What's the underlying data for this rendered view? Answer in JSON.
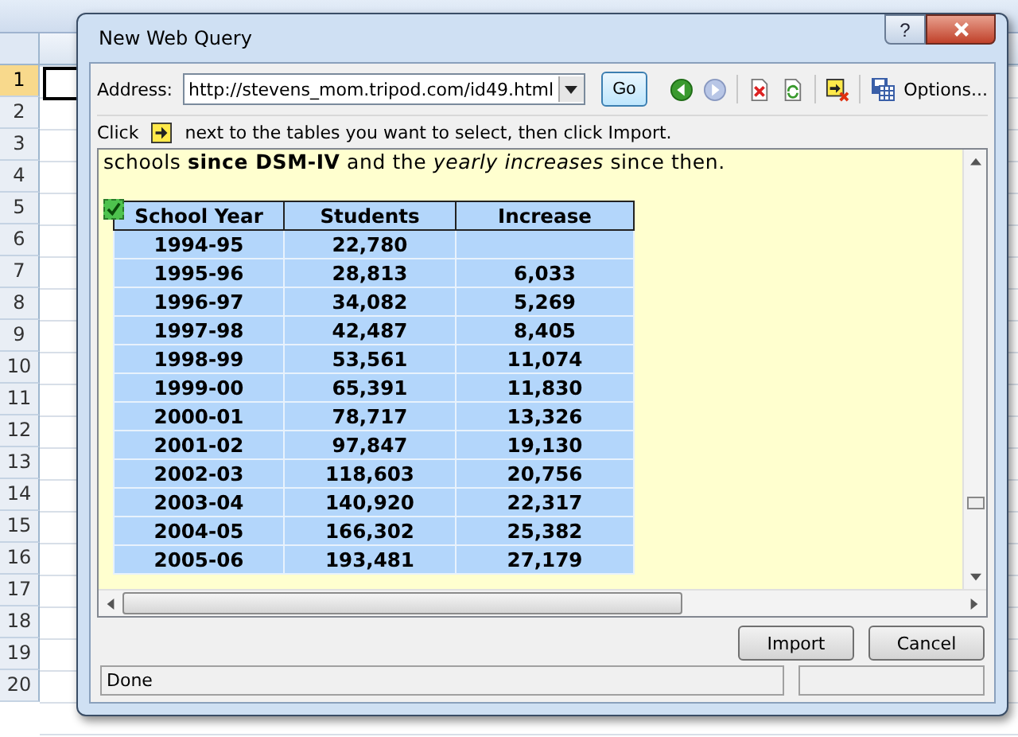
{
  "sheet": {
    "rows": [
      {
        "label": "1",
        "selected": true
      },
      {
        "label": "2",
        "selected": false
      },
      {
        "label": "3",
        "selected": false
      },
      {
        "label": "4",
        "selected": false
      },
      {
        "label": "5",
        "selected": false
      },
      {
        "label": "6",
        "selected": false
      },
      {
        "label": "7",
        "selected": false
      },
      {
        "label": "8",
        "selected": false
      },
      {
        "label": "9",
        "selected": false
      },
      {
        "label": "10",
        "selected": false
      },
      {
        "label": "11",
        "selected": false
      },
      {
        "label": "12",
        "selected": false
      },
      {
        "label": "13",
        "selected": false
      },
      {
        "label": "14",
        "selected": false
      },
      {
        "label": "15",
        "selected": false
      },
      {
        "label": "16",
        "selected": false
      },
      {
        "label": "17",
        "selected": false
      },
      {
        "label": "18",
        "selected": false
      },
      {
        "label": "19",
        "selected": false
      },
      {
        "label": "20",
        "selected": false
      }
    ]
  },
  "window": {
    "title": "New Web Query",
    "help": "?"
  },
  "address": {
    "label": "Address:",
    "value": "http://stevens_mom.tripod.com/id49.html",
    "go": "Go",
    "options": "Options..."
  },
  "instruction": {
    "before": "Click",
    "after": "next to the tables you want to select, then click Import."
  },
  "page": {
    "intro": "schools **since DSM-IV** and the *yearly increases* since then.",
    "table": {
      "checked": true,
      "columns": [
        "School Year",
        "Students",
        "Increase"
      ],
      "rows": [
        [
          "1994-95",
          "22,780",
          ""
        ],
        [
          "1995-96",
          "28,813",
          "6,033"
        ],
        [
          "1996-97",
          "34,082",
          "5,269"
        ],
        [
          "1997-98",
          "42,487",
          "8,405"
        ],
        [
          "1998-99",
          "53,561",
          "11,074"
        ],
        [
          "1999-00",
          "65,391",
          "11,830"
        ],
        [
          "2000-01",
          "78,717",
          "13,326"
        ],
        [
          "2001-02",
          "97,847",
          "19,130"
        ],
        [
          "2002-03",
          "118,603",
          "20,756"
        ],
        [
          "2003-04",
          "140,920",
          "22,317"
        ],
        [
          "2004-05",
          "166,302",
          "25,382"
        ],
        [
          "2005-06",
          "193,481",
          "27,179"
        ]
      ]
    }
  },
  "buttons": [
    "Import",
    "Cancel"
  ],
  "status_bar": "Done"
}
